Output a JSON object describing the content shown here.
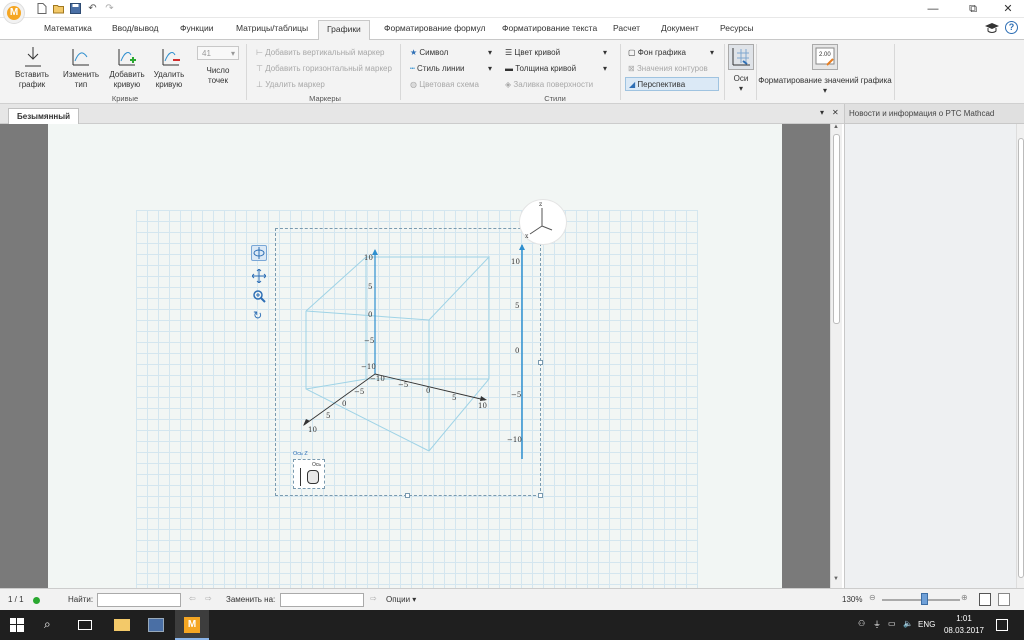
{
  "app": {
    "logo_letter": "M",
    "accent": "#f5a623"
  },
  "ribbon_tabs": [
    {
      "label": "Математика"
    },
    {
      "label": "Ввод/вывод"
    },
    {
      "label": "Функции"
    },
    {
      "label": "Матрицы/таблицы"
    },
    {
      "label": "Графики",
      "active": true
    },
    {
      "label": "Форматирование формул"
    },
    {
      "label": "Форматирование текста"
    },
    {
      "label": "Расчет"
    },
    {
      "label": "Документ"
    },
    {
      "label": "Ресурсы"
    }
  ],
  "ribbon": {
    "insert_plot": [
      "Вставить",
      "график"
    ],
    "change_type": [
      "Изменить",
      "тип"
    ],
    "add_curve": [
      "Добавить",
      "кривую"
    ],
    "delete_curve": [
      "Удалить",
      "кривую"
    ],
    "points_value": "41",
    "points_label": [
      "Число",
      "точек"
    ],
    "group_curves": "Кривые",
    "add_vertical_marker": "Добавить вертикальный маркер",
    "add_horizontal_marker": "Добавить горизонтальный маркер",
    "delete_marker": "Удалить маркер",
    "group_markers": "Маркеры",
    "symbol": "Символ",
    "line_style": "Стиль линии",
    "color_scheme": "Цветовая схема",
    "curve_color": "Цвет кривой",
    "curve_thickness": "Толщина кривой",
    "surface_fill": "Заливка поверхности",
    "group_styles": "Стили",
    "plot_background": "Фон графика",
    "contour_values": "Значения контуров",
    "perspective": "Перспектива",
    "axes": "Оси",
    "format_values": "Форматирование значений графика"
  },
  "document": {
    "tab_title": "Безымянный"
  },
  "plot": {
    "z_ticks": [
      "10",
      "5",
      "0",
      "−5",
      "−10"
    ],
    "x_ticks": [
      "−10",
      "−5",
      "0",
      "5",
      "10"
    ],
    "y_ticks": [
      "10",
      "5",
      "0",
      "−5"
    ],
    "side_ticks": [
      "10",
      "5",
      "0",
      "−5",
      "−10"
    ],
    "axis_label": "Ось Z",
    "placeholder_label": "Ось",
    "compass_z": "z",
    "compass_x": "x",
    "box_color": "#9fd3e6",
    "axis_color": "#2e8fcf"
  },
  "right_panel": {
    "title": "Новости и информация о PTC Mathcad"
  },
  "status": {
    "page": "1 / 1",
    "find_label": "Найти:",
    "replace_label": "Заменить на:",
    "options_label": "Опции",
    "zoom": "130%"
  },
  "taskbar": {
    "lang": "ENG",
    "time": "1:01",
    "date": "08.03.2017"
  }
}
